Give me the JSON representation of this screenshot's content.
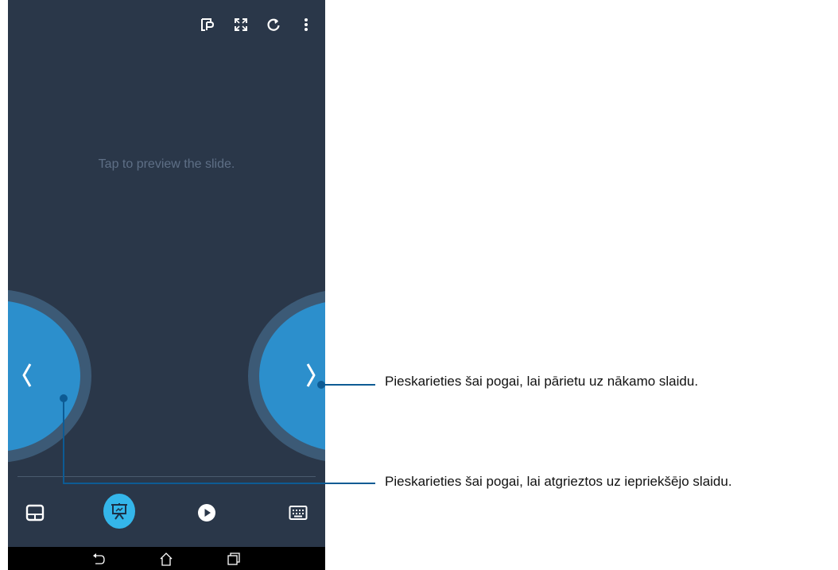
{
  "app": {
    "preview_text": "Tap to preview the slide.",
    "topbar": {
      "icons": [
        "presenter-notes-icon",
        "fullscreen-icon",
        "refresh-icon",
        "more-vert-icon"
      ]
    },
    "nav": {
      "prev_glyph": "‹",
      "next_glyph": "›"
    },
    "bottom_toolbar": {
      "icons": [
        "touchpad-icon",
        "presentation-icon",
        "play-icon",
        "keyboard-icon"
      ],
      "active": "presentation-icon"
    },
    "system_nav": {
      "icons": [
        "back-icon",
        "home-icon",
        "recents-icon"
      ]
    },
    "colors": {
      "background": "#2a3749",
      "nav_button": "#2c8fcc",
      "nav_button_ring": "#3c5a76",
      "active_tool": "#34b6ea",
      "callout": "#0d5b94"
    }
  },
  "callouts": {
    "next": "Pieskarieties šai pogai, lai pārietu uz nākamo slaidu.",
    "prev": "Pieskarieties šai pogai, lai atgrieztos uz iepriekšējo slaidu."
  }
}
